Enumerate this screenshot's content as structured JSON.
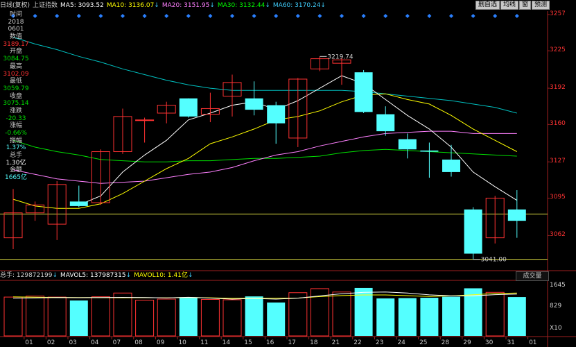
{
  "header": {
    "period": "日线(复权)",
    "index_name": "上证指数",
    "ma5_label": "MA5: 3093.52",
    "ma10_label": "MA10: 3136.07",
    "ma20_label": "MA20: 3151.95",
    "ma30_label": "MA30: 3132.44",
    "ma60_label": "MA60: 3170.24",
    "down_arrow": "↓"
  },
  "toolbar": {
    "buttons": [
      "删自选",
      "均线",
      "窗",
      "预测"
    ]
  },
  "info_panel": {
    "time_label": "时间",
    "year": "2018",
    "date": "0601",
    "value_label": "数值",
    "value": "3189.17",
    "open_label": "开盘",
    "open": "3084.75",
    "high_label": "最高",
    "high": "3102.09",
    "low_label": "最低",
    "low": "3059.79",
    "close_label": "收盘",
    "close": "3075.14",
    "change_label": "涨跌",
    "change": "-20.33",
    "pct_label": "涨幅",
    "pct": "-0.66%",
    "amp_label": "振幅",
    "amp": "1.37%",
    "vol_label": "总手",
    "vol": "1.30亿",
    "amt_label": "金额",
    "amt": "1665亿"
  },
  "price_axis": [
    "3257",
    "3225",
    "3192",
    "3160",
    "3127",
    "3095",
    "3062"
  ],
  "annotations": {
    "high": "3219.74",
    "low": "3041.00"
  },
  "volume_header": {
    "total": "总手: 129872199",
    "mavol5": "MAVOL5: 137987315",
    "mavol10": "MAVOL10: 1.41亿"
  },
  "volume_button": "成交量",
  "volume_axis": [
    "1645",
    "829",
    "X10"
  ],
  "colors": {
    "up": "#ff3232",
    "down": "#54ffff",
    "ma5": "#ffffff",
    "ma10": "#ffff00",
    "ma20": "#ff80ff",
    "ma30": "#00e000",
    "ma60": "#00c0c0",
    "header_ma5": "#ffffff",
    "header_ma10": "#ffff00",
    "header_ma20": "#ff80ff",
    "header_ma30": "#00ff00",
    "header_ma60": "#40d0ff"
  },
  "chart_data": {
    "type": "candlestick",
    "dates": [
      "01",
      "02",
      "03",
      "04",
      "07",
      "08",
      "09",
      "10",
      "11",
      "14",
      "15",
      "16",
      "17",
      "18",
      "21",
      "22",
      "23",
      "24",
      "25",
      "28",
      "29",
      "30",
      "31",
      "01"
    ],
    "ohlc": [
      {
        "o": 3060,
        "h": 3103,
        "l": 3050,
        "c": 3082
      },
      {
        "o": 3082,
        "h": 3092,
        "l": 3075,
        "c": 3089
      },
      {
        "o": 3072,
        "h": 3110,
        "l": 3058,
        "c": 3107
      },
      {
        "o": 3092,
        "h": 3106,
        "l": 3087,
        "c": 3088
      },
      {
        "o": 3091,
        "h": 3138,
        "l": 3089,
        "c": 3136
      },
      {
        "o": 3136,
        "h": 3174,
        "l": 3134,
        "c": 3167
      },
      {
        "o": 3164,
        "h": 3166,
        "l": 3144,
        "c": 3164
      },
      {
        "o": 3170,
        "h": 3180,
        "l": 3161,
        "c": 3177
      },
      {
        "o": 3183,
        "h": 3183,
        "l": 3166,
        "c": 3167
      },
      {
        "o": 3169,
        "h": 3188,
        "l": 3162,
        "c": 3174
      },
      {
        "o": 3185,
        "h": 3204,
        "l": 3167,
        "c": 3197
      },
      {
        "o": 3183,
        "h": 3198,
        "l": 3168,
        "c": 3173
      },
      {
        "o": 3177,
        "h": 3180,
        "l": 3143,
        "c": 3161
      },
      {
        "o": 3148,
        "h": 3201,
        "l": 3140,
        "c": 3200
      },
      {
        "o": 3209,
        "h": 3220,
        "l": 3207,
        "c": 3218
      },
      {
        "o": 3214,
        "h": 3219,
        "l": 3195,
        "c": 3217
      },
      {
        "o": 3206,
        "h": 3208,
        "l": 3170,
        "c": 3171
      },
      {
        "o": 3169,
        "h": 3176,
        "l": 3150,
        "c": 3154
      },
      {
        "o": 3147,
        "h": 3152,
        "l": 3130,
        "c": 3138
      },
      {
        "o": 3137,
        "h": 3144,
        "l": 3113,
        "c": 3136
      },
      {
        "o": 3129,
        "h": 3142,
        "l": 3114,
        "c": 3118
      },
      {
        "o": 3085,
        "h": 3087,
        "l": 3041,
        "c": 3046
      },
      {
        "o": 3060,
        "h": 3097,
        "l": 3055,
        "c": 3095
      },
      {
        "o": 3085,
        "h": 3102,
        "l": 3060,
        "c": 3075
      }
    ],
    "ma5": [
      null,
      null,
      null,
      3089,
      3097,
      3118,
      3133,
      3146,
      3164,
      3170,
      3177,
      3180,
      3173,
      3181,
      3192,
      3203,
      3196,
      3182,
      3168,
      3156,
      3140,
      3118,
      3105,
      3093
    ],
    "ma10": [
      3094,
      3088,
      3086,
      3086,
      3090,
      3099,
      3110,
      3121,
      3130,
      3143,
      3149,
      3156,
      3164,
      3167,
      3172,
      3180,
      3186,
      3187,
      3182,
      3178,
      3168,
      3156,
      3146,
      3136
    ],
    "ma20": [
      3120,
      3116,
      3112,
      3110,
      3108,
      3109,
      3110,
      3113,
      3116,
      3118,
      3122,
      3128,
      3133,
      3136,
      3141,
      3145,
      3149,
      3152,
      3153,
      3154,
      3154,
      3152,
      3152,
      3152
    ],
    "ma30": [
      3146,
      3140,
      3136,
      3133,
      3129,
      3128,
      3127,
      3127,
      3128,
      3128,
      3129,
      3130,
      3130,
      3131,
      3132,
      3135,
      3137,
      3138,
      3137,
      3136,
      3135,
      3134,
      3133,
      3132
    ],
    "ma60": [
      3237,
      3231,
      3226,
      3220,
      3215,
      3209,
      3204,
      3199,
      3195,
      3192,
      3190,
      3190,
      3190,
      3190,
      3190,
      3190,
      3189,
      3187,
      3185,
      3183,
      3181,
      3178,
      3175,
      3170
    ],
    "volume": [
      1150,
      1180,
      1150,
      1050,
      1160,
      1270,
      1060,
      1090,
      1140,
      1080,
      1070,
      1170,
      990,
      1280,
      1400,
      1300,
      1420,
      1110,
      1120,
      1130,
      1160,
      1410,
      1290,
      1150
    ],
    "mavol5": [
      1120,
      1125,
      1135,
      1130,
      1136,
      1142,
      1138,
      1124,
      1144,
      1120,
      1089,
      1110,
      1090,
      1118,
      1184,
      1248,
      1290,
      1302,
      1268,
      1216,
      1188,
      1186,
      1222,
      1239
    ],
    "mavol10": [
      1155,
      1145,
      1140,
      1138,
      1133,
      1130,
      1133,
      1129,
      1140,
      1128,
      1113,
      1118,
      1114,
      1121,
      1164,
      1195,
      1214,
      1213,
      1193,
      1167,
      1184,
      1217,
      1256,
      1270
    ],
    "ylim": [
      3031,
      3260
    ],
    "vol_ylim": [
      0,
      1645
    ],
    "ref_lines": [
      3081,
      3041
    ]
  }
}
